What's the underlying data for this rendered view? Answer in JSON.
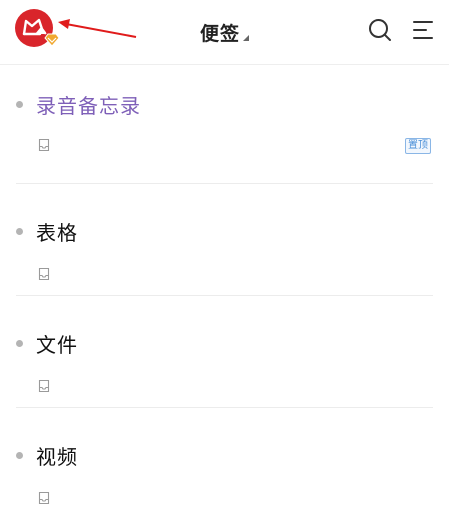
{
  "header": {
    "title": "便签",
    "avatar_icon": "cat-logo-icon",
    "vip_icon": "vip-diamond-icon",
    "search_icon": "search-icon",
    "menu_icon": "menu-icon"
  },
  "notes": [
    {
      "title": "录音备忘录",
      "pinned_label": "置顶",
      "title_color": "#7e5fb8"
    },
    {
      "title": "表格"
    },
    {
      "title": "文件"
    },
    {
      "title": "视频"
    }
  ],
  "colors": {
    "accent": "#d9252b",
    "vip": "#f0a830",
    "pin": "#4a8fd8"
  }
}
